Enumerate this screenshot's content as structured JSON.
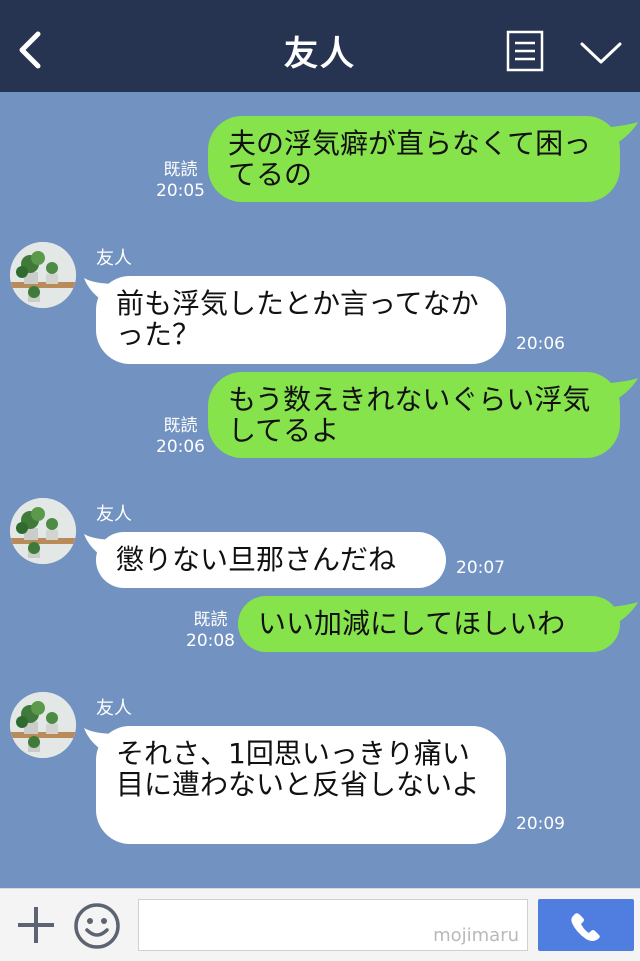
{
  "header": {
    "title": "友人"
  },
  "messages": [
    {
      "side": "me",
      "text": "夫の浮気癖が直らなくて困ってるの",
      "read": "既読",
      "time": "20:05"
    },
    {
      "side": "them",
      "sender": "友人",
      "text": "前も浮気したとか言ってなかった？",
      "time": "20:06"
    },
    {
      "side": "me",
      "text": "もう数えきれないぐらい浮気してるよ",
      "read": "既読",
      "time": "20:06"
    },
    {
      "side": "them",
      "sender": "友人",
      "text": "懲りない旦那さんだね",
      "time": "20:07"
    },
    {
      "side": "me",
      "text": "いい加減にしてほしいわ",
      "read": "既読",
      "time": "20:08"
    },
    {
      "side": "them",
      "sender": "友人",
      "text": "それさ、1回思いっきり痛い目に遭わないと反省しないよ",
      "time": "20:09"
    }
  ],
  "footer": {
    "input_value": "",
    "watermark": "mojimaru"
  },
  "colors": {
    "header": "#263351",
    "background": "#7292c1",
    "my_bubble": "#86e34b",
    "their_bubble": "#ffffff",
    "call_button": "#4f7ee0"
  },
  "icons": [
    "back-arrow-icon",
    "menu-list-icon",
    "chevron-down-icon",
    "plus-icon",
    "emoji-icon",
    "phone-icon"
  ]
}
